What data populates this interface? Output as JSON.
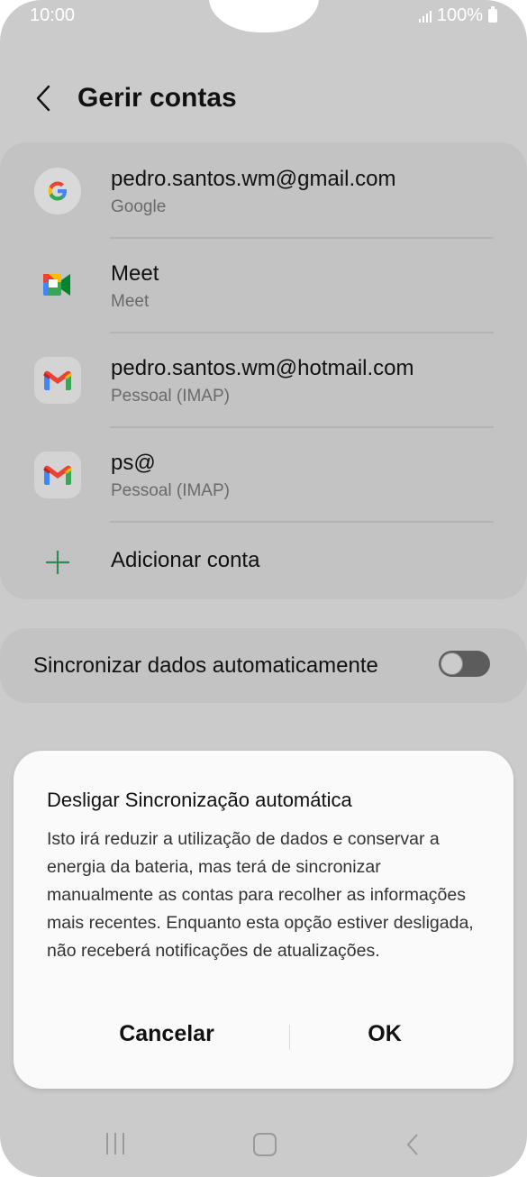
{
  "status_bar": {
    "time": "10:00",
    "battery": "100%"
  },
  "header": {
    "title": "Gerir contas"
  },
  "accounts": [
    {
      "primary": "pedro.santos.wm@gmail.com",
      "secondary": "Google",
      "icon": "google-icon"
    },
    {
      "primary": "Meet",
      "secondary": "Meet",
      "icon": "meet-icon"
    },
    {
      "primary": "pedro.santos.wm@hotmail.com",
      "secondary": "Pessoal (IMAP)",
      "icon": "gmail-icon"
    },
    {
      "primary": "ps@",
      "secondary": "Pessoal (IMAP)",
      "icon": "gmail-icon"
    }
  ],
  "add_account": {
    "label": "Adicionar conta",
    "icon": "plus-icon"
  },
  "sync": {
    "label": "Sincronizar dados automaticamente",
    "enabled": false
  },
  "dialog": {
    "title": "Desligar Sincronização automática",
    "body": "Isto irá reduzir a utilização de dados e conservar a energia da bateria, mas terá de sincronizar manualmente as contas para recolher as informações mais recentes. Enquanto esta opção estiver desligada, não receberá notificações de atualizações.",
    "cancel_label": "Cancelar",
    "ok_label": "OK"
  },
  "colors": {
    "accent_green": "#2e8b57",
    "background": "#cbcbcb",
    "dialog": "#fafafa"
  }
}
